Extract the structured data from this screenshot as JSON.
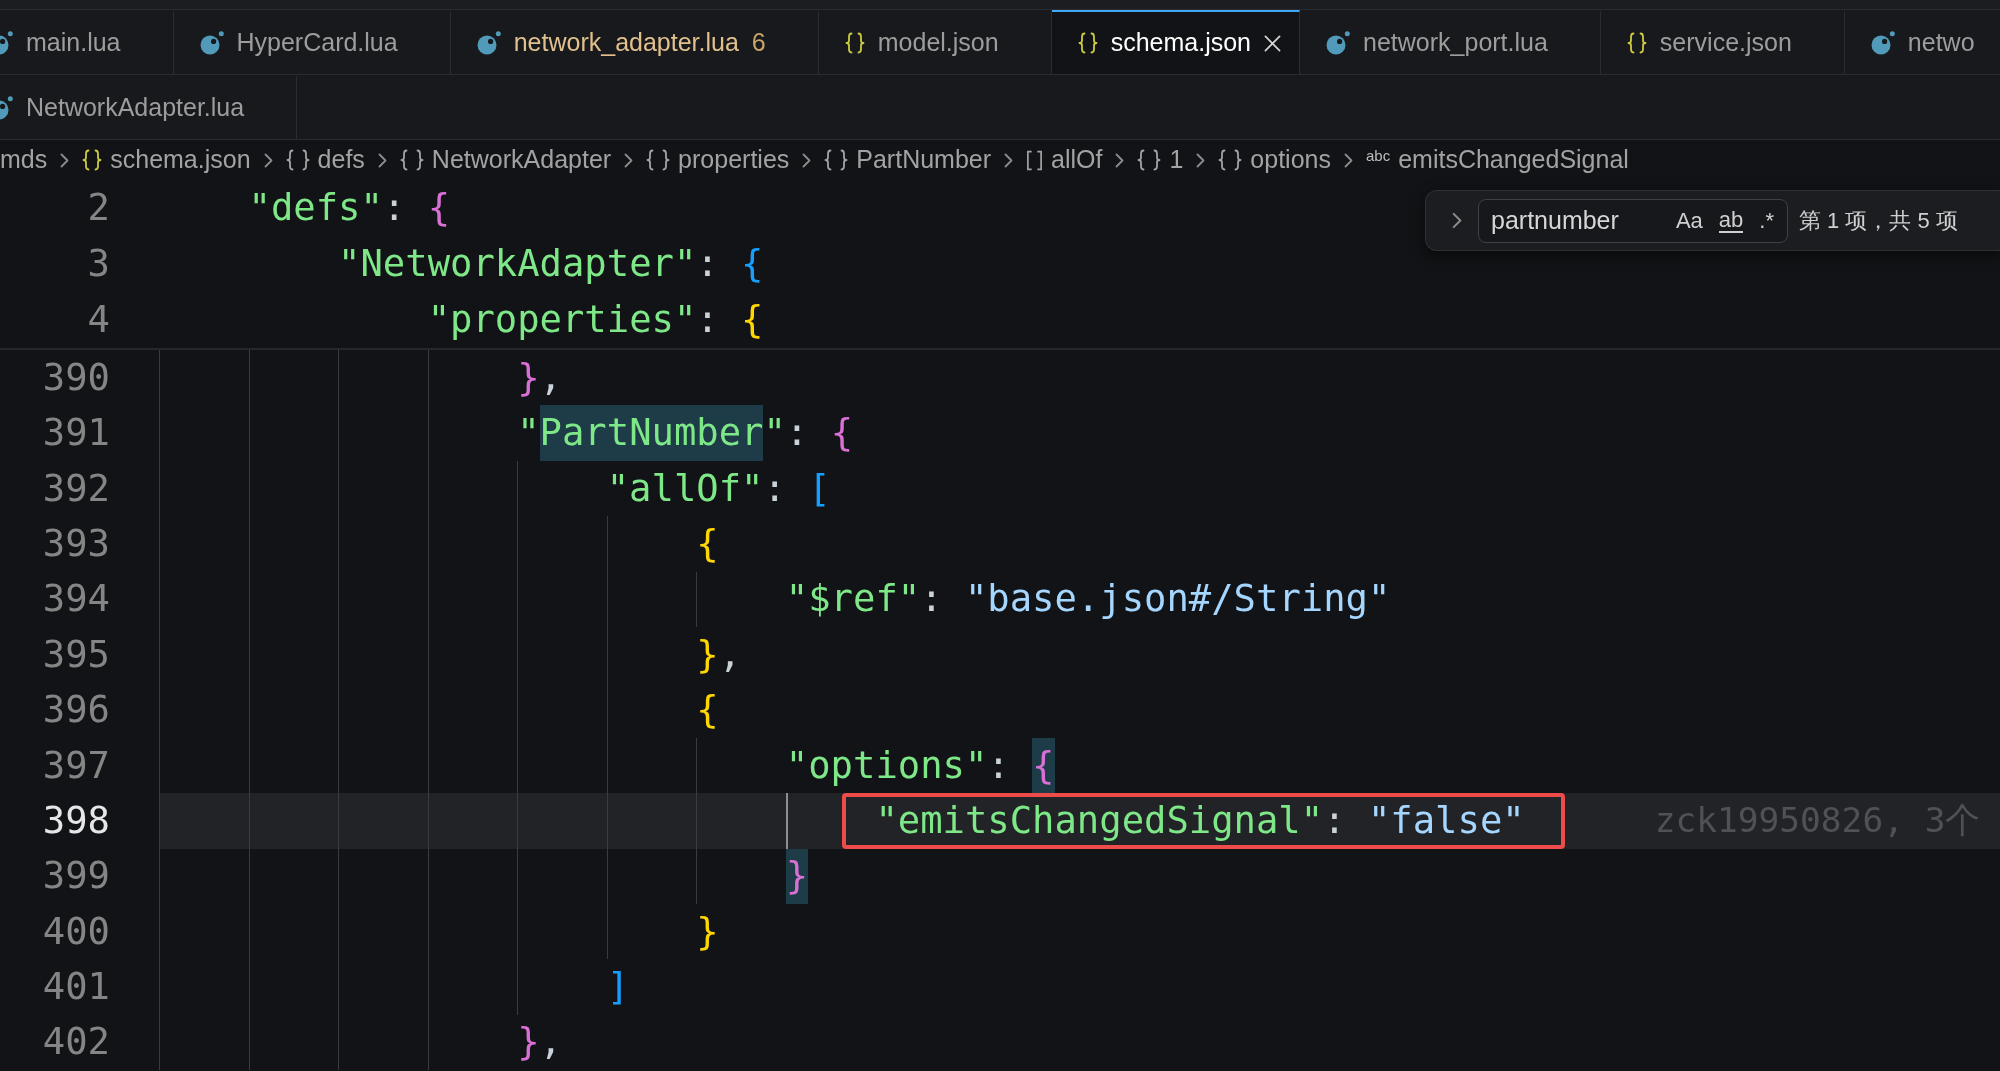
{
  "tab_rows": [
    {
      "tabs": [
        {
          "label": "main.lua",
          "kind": "lua",
          "selected": false,
          "warning": false
        },
        {
          "label": "HyperCard.lua",
          "kind": "lua",
          "selected": false,
          "warning": false
        },
        {
          "label": "network_adapter.lua",
          "kind": "lua",
          "selected": false,
          "warning": true,
          "problems": "6"
        },
        {
          "label": "model.json",
          "kind": "json",
          "selected": false,
          "warning": false
        },
        {
          "label": "schema.json",
          "kind": "json",
          "selected": true,
          "warning": false
        },
        {
          "label": "network_port.lua",
          "kind": "lua",
          "selected": false,
          "warning": false
        },
        {
          "label": "service.json",
          "kind": "json",
          "selected": false,
          "warning": false
        },
        {
          "label": "netwo",
          "kind": "lua",
          "selected": false,
          "warning": false
        }
      ]
    },
    {
      "tabs": [
        {
          "label": "NetworkAdapter.lua",
          "kind": "lua",
          "selected": false,
          "warning": false
        }
      ]
    }
  ],
  "breadcrumbs": [
    {
      "label": "mds",
      "kind": "folder"
    },
    {
      "label": "schema.json",
      "kind": "file"
    },
    {
      "label": "defs",
      "kind": "object"
    },
    {
      "label": "NetworkAdapter",
      "kind": "object"
    },
    {
      "label": "properties",
      "kind": "object"
    },
    {
      "label": "PartNumber",
      "kind": "object"
    },
    {
      "label": "allOf",
      "kind": "array"
    },
    {
      "label": "1",
      "kind": "object"
    },
    {
      "label": "options",
      "kind": "object"
    },
    {
      "label": "emitsChangedSignal",
      "kind": "string",
      "symbol": "abc"
    }
  ],
  "find_widget": {
    "replace_expanded": false,
    "value": "partnumber",
    "options": [
      {
        "label": "Aa",
        "kind": "case",
        "on": false
      },
      {
        "label": "ab",
        "kind": "word",
        "on": false
      },
      {
        "label": ".*",
        "kind": "regex",
        "on": false
      }
    ],
    "result": "第 1 项，共 5 项"
  },
  "sticky_lines": [
    {
      "number": "2",
      "tokens": [
        {
          "kind": "key",
          "text": "\"defs\""
        },
        {
          "kind": "punct",
          "text": ": "
        },
        {
          "kind": "bracket",
          "text": "{"
        }
      ],
      "children": [
        {
          "number": "3",
          "tokens": [
            {
              "kind": "key",
              "text": "\"NetworkAdapter\""
            },
            {
              "kind": "punct",
              "text": ": "
            },
            {
              "kind": "bracket",
              "text": "{"
            }
          ],
          "children": [
            {
              "number": "4",
              "tokens": [
                {
                  "kind": "key",
                  "text": "\"properties\""
                },
                {
                  "kind": "punct",
                  "text": ": "
                },
                {
                  "kind": "bracket",
                  "text": "{"
                }
              ]
            }
          ]
        }
      ]
    }
  ],
  "code_lines": [
    {
      "number": "390",
      "current": false,
      "outlined": false,
      "guides": [
        {
          "active": false
        },
        {
          "active": false
        },
        {
          "active": false
        },
        {
          "active": false
        }
      ],
      "tokens": [
        {
          "kind": "bracket",
          "text": "}"
        },
        {
          "kind": "punct",
          "text": ","
        }
      ]
    },
    {
      "number": "391",
      "current": false,
      "outlined": false,
      "guides": [
        {
          "active": false
        },
        {
          "active": false
        },
        {
          "active": false
        },
        {
          "active": false
        }
      ],
      "tokens": [
        {
          "kind": "key",
          "text": "\""
        },
        {
          "kind": "match",
          "text": "PartNumber"
        },
        {
          "kind": "key",
          "text": "\""
        },
        {
          "kind": "punct",
          "text": ": "
        },
        {
          "kind": "bracket",
          "text": "{"
        }
      ]
    },
    {
      "number": "392",
      "current": false,
      "outlined": false,
      "guides": [
        {
          "active": false
        },
        {
          "active": false
        },
        {
          "active": false
        },
        {
          "active": false
        },
        {
          "active": false
        }
      ],
      "tokens": [
        {
          "kind": "key",
          "text": "\"allOf\""
        },
        {
          "kind": "punct",
          "text": ": "
        },
        {
          "kind": "bracket",
          "text": "["
        }
      ]
    },
    {
      "number": "393",
      "current": false,
      "outlined": false,
      "guides": [
        {
          "active": false
        },
        {
          "active": false
        },
        {
          "active": false
        },
        {
          "active": false
        },
        {
          "active": false
        },
        {
          "active": false
        }
      ],
      "tokens": [
        {
          "kind": "bracket",
          "text": "{"
        }
      ]
    },
    {
      "number": "394",
      "current": false,
      "outlined": false,
      "guides": [
        {
          "active": false
        },
        {
          "active": false
        },
        {
          "active": false
        },
        {
          "active": false
        },
        {
          "active": false
        },
        {
          "active": false
        },
        {
          "active": false
        }
      ],
      "tokens": [
        {
          "kind": "key",
          "text": "\"$ref\""
        },
        {
          "kind": "punct",
          "text": ": "
        },
        {
          "kind": "str",
          "text": "\"base.json#/String\""
        }
      ]
    },
    {
      "number": "395",
      "current": false,
      "outlined": false,
      "guides": [
        {
          "active": false
        },
        {
          "active": false
        },
        {
          "active": false
        },
        {
          "active": false
        },
        {
          "active": false
        },
        {
          "active": false
        }
      ],
      "tokens": [
        {
          "kind": "bracket",
          "text": "}"
        },
        {
          "kind": "punct",
          "text": ","
        }
      ]
    },
    {
      "number": "396",
      "current": false,
      "outlined": false,
      "guides": [
        {
          "active": false
        },
        {
          "active": false
        },
        {
          "active": false
        },
        {
          "active": false
        },
        {
          "active": false
        },
        {
          "active": false
        }
      ],
      "tokens": [
        {
          "kind": "bracket",
          "text": "{"
        }
      ]
    },
    {
      "number": "397",
      "current": false,
      "outlined": false,
      "guides": [
        {
          "active": false
        },
        {
          "active": false
        },
        {
          "active": false
        },
        {
          "active": false
        },
        {
          "active": false
        },
        {
          "active": false
        },
        {
          "active": false
        }
      ],
      "tokens": [
        {
          "kind": "key",
          "text": "\"options\""
        },
        {
          "kind": "punct",
          "text": ": "
        },
        {
          "kind": "pair",
          "text": "{"
        }
      ]
    },
    {
      "number": "398",
      "current": true,
      "outlined": true,
      "blame": "zck19950826, 3个",
      "guides": [
        {
          "active": false
        },
        {
          "active": false
        },
        {
          "active": false
        },
        {
          "active": false
        },
        {
          "active": false
        },
        {
          "active": false
        },
        {
          "active": false
        },
        {
          "active": true
        }
      ],
      "tokens": [
        {
          "kind": "key",
          "text": "\"emitsChangedSignal\""
        },
        {
          "kind": "punct",
          "text": ": "
        },
        {
          "kind": "str",
          "text": "\"false\""
        }
      ]
    },
    {
      "number": "399",
      "current": false,
      "outlined": false,
      "guides": [
        {
          "active": false
        },
        {
          "active": false
        },
        {
          "active": false
        },
        {
          "active": false
        },
        {
          "active": false
        },
        {
          "active": false
        },
        {
          "active": false
        }
      ],
      "tokens": [
        {
          "kind": "pair",
          "text": "}"
        }
      ]
    },
    {
      "number": "400",
      "current": false,
      "outlined": false,
      "guides": [
        {
          "active": false
        },
        {
          "active": false
        },
        {
          "active": false
        },
        {
          "active": false
        },
        {
          "active": false
        },
        {
          "active": false
        }
      ],
      "tokens": [
        {
          "kind": "bracket",
          "text": "}"
        }
      ]
    },
    {
      "number": "401",
      "current": false,
      "outlined": false,
      "guides": [
        {
          "active": false
        },
        {
          "active": false
        },
        {
          "active": false
        },
        {
          "active": false
        },
        {
          "active": false
        }
      ],
      "tokens": [
        {
          "kind": "bracket",
          "text": "]"
        }
      ]
    },
    {
      "number": "402",
      "current": false,
      "outlined": false,
      "guides": [
        {
          "active": false
        },
        {
          "active": false
        },
        {
          "active": false
        },
        {
          "active": false
        }
      ],
      "tokens": [
        {
          "kind": "bracket",
          "text": "}"
        },
        {
          "kind": "punct",
          "text": ","
        }
      ]
    }
  ]
}
